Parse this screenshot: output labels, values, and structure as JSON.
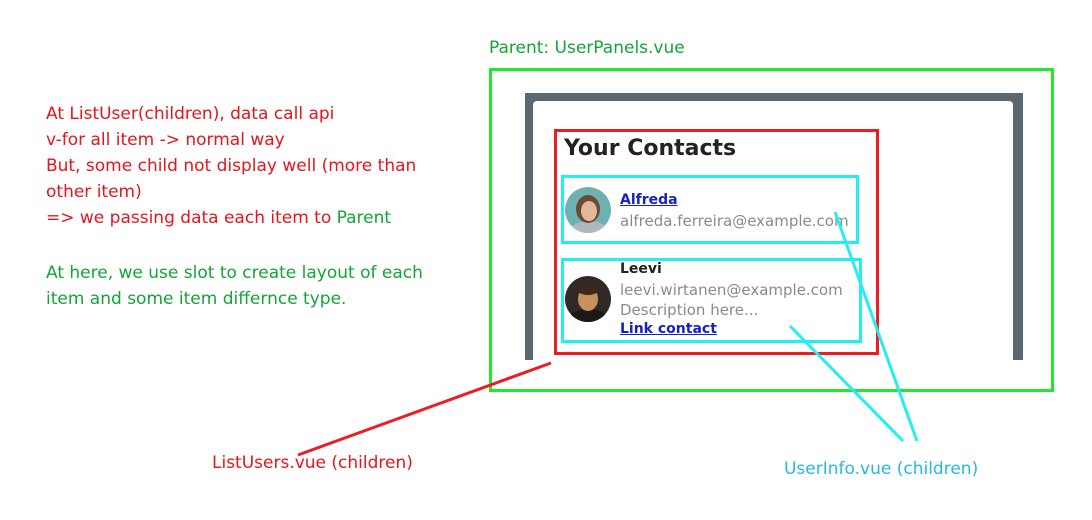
{
  "explanation_red": [
    "At ListUser(children), data call api",
    "v-for all item -> normal way",
    "But, some child not display well (more than",
    "other item)"
  ],
  "explanation_passing": {
    "prefix": "=> we passing data each item to ",
    "highlight": "Parent"
  },
  "explanation_green": [
    "At here, we use slot to create layout of each",
    "item and some item differnce type."
  ],
  "parent_label": "Parent: UserPanels.vue",
  "list_title": "Your Contacts",
  "users": [
    {
      "name": "Alfreda",
      "email": "alfreda.ferreira@example.com"
    },
    {
      "name": "Leevi",
      "email": "leevi.wirtanen@example.com",
      "description": "Description here...",
      "link": "Link contact"
    }
  ],
  "label_list_users": "ListUsers.vue (children)",
  "label_user_info": "UserInfo.vue (children)",
  "colors": {
    "parent_border": "#21e82a",
    "list_border": "#ea1d22",
    "user_border": "#25eef0",
    "frame": "#5b6771",
    "note_red": "#e8141b",
    "note_green": "#13a538",
    "note_cyan": "#25b9e0"
  }
}
